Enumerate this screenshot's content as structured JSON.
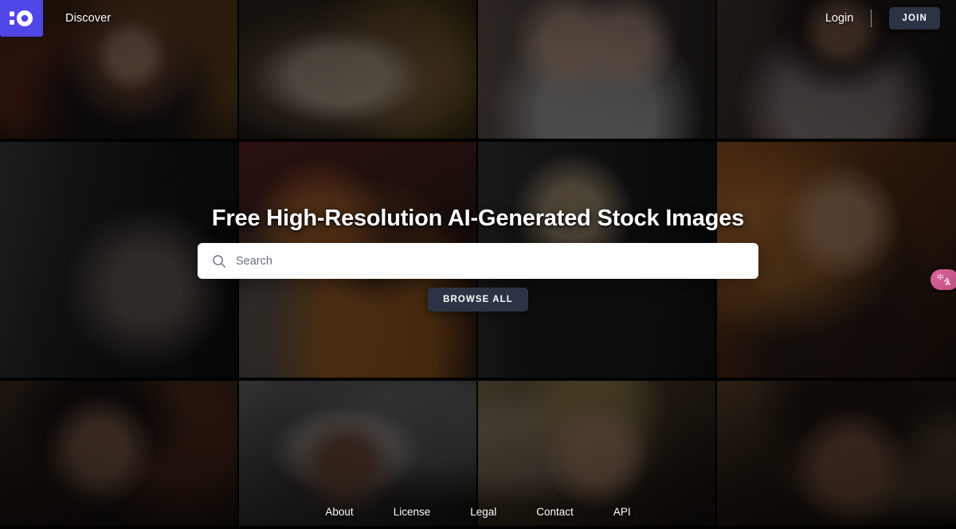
{
  "header": {
    "logo_icon": "colon-circle-logo-icon",
    "logo_color": "#4f46e8",
    "nav_links": [
      {
        "label": "Discover",
        "name": "nav-link-discover"
      }
    ],
    "login_label": "Login",
    "join_label": "JOIN",
    "join_bg": "#2b3345"
  },
  "hero": {
    "title": "Free High-Resolution AI-Generated Stock Images",
    "search": {
      "icon": "search-icon",
      "placeholder": "Search",
      "value": ""
    },
    "browse_label": "BROWSE ALL",
    "browse_bg": "#2b3345"
  },
  "footer": {
    "links": [
      {
        "label": "About",
        "name": "footer-link-about"
      },
      {
        "label": "License",
        "name": "footer-link-license"
      },
      {
        "label": "Legal",
        "name": "footer-link-legal"
      },
      {
        "label": "Contact",
        "name": "footer-link-contact"
      },
      {
        "label": "API",
        "name": "footer-link-api"
      }
    ]
  },
  "translate_widget": {
    "icon": "translate-icon",
    "glyph_primary": "中",
    "glyph_secondary": "A",
    "color": "#c9538a"
  },
  "mosaic": {
    "columns": 4,
    "rows": 3,
    "tiles": [
      {
        "name": "photo-tile-1",
        "alt": "Woman in orange jacket at golden hour"
      },
      {
        "name": "photo-tile-2",
        "alt": "Blonde woman from behind in floral coat"
      },
      {
        "name": "photo-tile-3",
        "alt": "Two smiling young women outdoors"
      },
      {
        "name": "photo-tile-4",
        "alt": "Curly-haired woman in grey sweatshirt"
      },
      {
        "name": "photo-tile-5",
        "alt": "Mother and daughter by modern house"
      },
      {
        "name": "photo-tile-6",
        "alt": "Two women by red barn house"
      },
      {
        "name": "photo-tile-7",
        "alt": "Woman holding child by dark cabin"
      },
      {
        "name": "photo-tile-8",
        "alt": "Girl in hoodie at sunset dunes"
      },
      {
        "name": "photo-tile-9",
        "alt": "Man with curly hair on city street"
      },
      {
        "name": "photo-tile-10",
        "alt": "Woman wearing headscarf on street"
      },
      {
        "name": "photo-tile-11",
        "alt": "Blond man outdoors in warm light"
      },
      {
        "name": "photo-tile-12",
        "alt": "Woman with afro hair close-up"
      }
    ]
  }
}
